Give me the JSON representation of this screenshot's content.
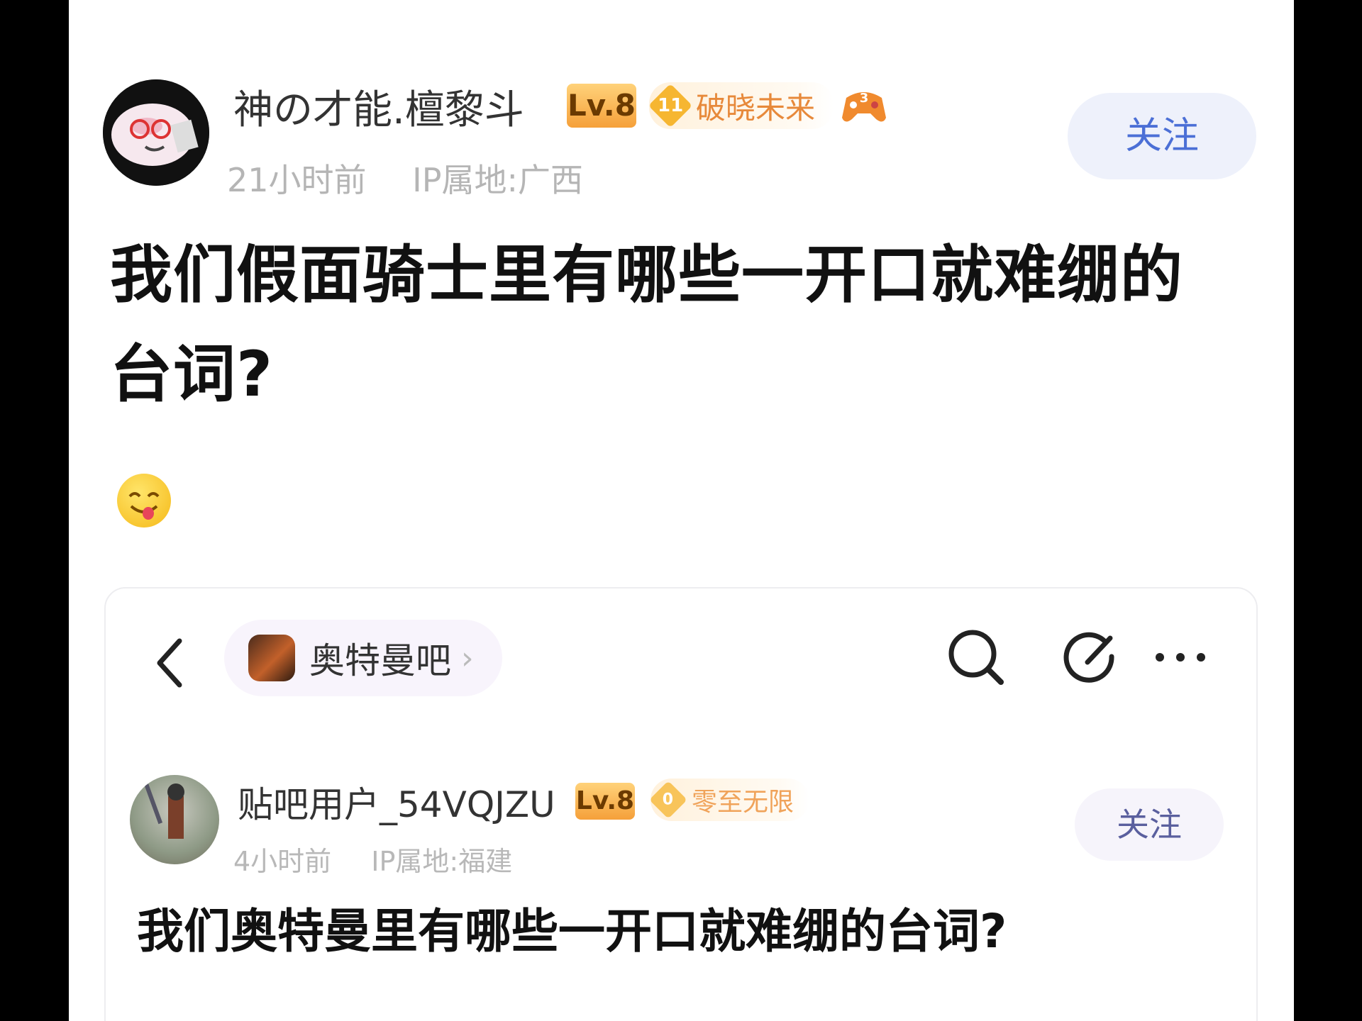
{
  "post": {
    "author": {
      "name": "神の才能.檀黎斗",
      "level": "Lv.8",
      "honor_level": "11",
      "honor_title": "破晓未来",
      "extra_badge_icon": "game-controller-icon"
    },
    "time": "21小时前",
    "ip_location": "IP属地:广西",
    "follow_label": "关注",
    "title": "我们假面骑士里有哪些一开口就难绷的台词?",
    "emoji": "yum-face-emoji"
  },
  "embedded": {
    "bar_name": "奥特曼吧",
    "author": {
      "name": "贴吧用户_54VQJZU",
      "level": "Lv.8",
      "honor_level": "0",
      "honor_title": "零至无限"
    },
    "time": "4小时前",
    "ip_location": "IP属地:福建",
    "follow_label": "关注",
    "title": "我们奥特曼里有哪些一开口就难绷的台词?"
  },
  "colors": {
    "accent_blue": "#4b6fd6",
    "level_badge": "#f5a03a",
    "honor_orange": "#e7893a"
  }
}
